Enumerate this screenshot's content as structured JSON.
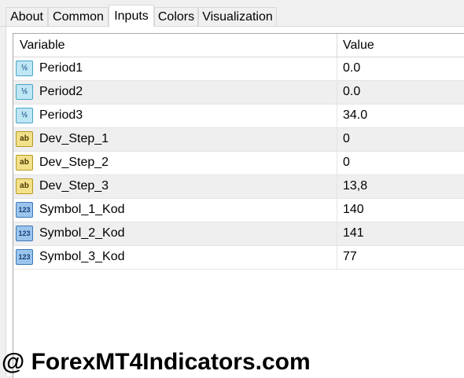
{
  "tabs": [
    {
      "label": "About"
    },
    {
      "label": "Common"
    },
    {
      "label": "Inputs"
    },
    {
      "label": "Colors"
    },
    {
      "label": "Visualization"
    }
  ],
  "active_tab": "Inputs",
  "table": {
    "headers": {
      "variable": "Variable",
      "value": "Value"
    },
    "rows": [
      {
        "icon": "double-type-icon",
        "icon_text": "½",
        "name": "Period1",
        "value": "0.0"
      },
      {
        "icon": "double-type-icon",
        "icon_text": "½",
        "name": "Period2",
        "value": "0.0"
      },
      {
        "icon": "double-type-icon",
        "icon_text": "½",
        "name": "Period3",
        "value": "34.0"
      },
      {
        "icon": "string-type-icon",
        "icon_text": "ab",
        "name": "Dev_Step_1",
        "value": "0"
      },
      {
        "icon": "string-type-icon",
        "icon_text": "ab",
        "name": "Dev_Step_2",
        "value": "0"
      },
      {
        "icon": "string-type-icon",
        "icon_text": "ab",
        "name": "Dev_Step_3",
        "value": "13,8"
      },
      {
        "icon": "integer-type-icon",
        "icon_text": "123",
        "name": "Symbol_1_Kod",
        "value": "140"
      },
      {
        "icon": "integer-type-icon",
        "icon_text": "123",
        "name": "Symbol_2_Kod",
        "value": "141"
      },
      {
        "icon": "integer-type-icon",
        "icon_text": "123",
        "name": "Symbol_3_Kod",
        "value": "77"
      }
    ]
  },
  "watermark": "@ ForexMT4Indicators.com"
}
